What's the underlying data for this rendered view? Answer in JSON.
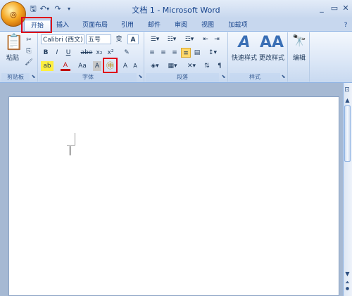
{
  "window": {
    "title": "文档 1 - Microsoft Word",
    "minimize": "_",
    "maximize": "▭",
    "close": "✕"
  },
  "qat": {
    "save": "🖫",
    "undo": "↶",
    "undo_drop": "▾",
    "redo": "↷",
    "customize": "▾"
  },
  "tabs": [
    "开始",
    "插入",
    "页面布局",
    "引用",
    "邮件",
    "审阅",
    "视图",
    "加载项"
  ],
  "help": "?",
  "clipboard": {
    "paste_label": "粘贴",
    "group_label": "剪贴板"
  },
  "font": {
    "family": "Calibri (西文)",
    "size": "五号",
    "change_case": "变",
    "char_border": "A",
    "bold": "B",
    "italic": "I",
    "underline": "U",
    "strike": "abe",
    "subscript": "x₂",
    "superscript": "x²",
    "clear_format": "✎",
    "highlight": "ab",
    "font_color": "A",
    "case": "Aa",
    "shading": "A",
    "enclosed": "㊥",
    "grow": "A",
    "shrink": "A",
    "group_label": "字体"
  },
  "paragraph": {
    "group_label": "段落"
  },
  "styles": {
    "quick_styles": "快速样式",
    "change_styles": "更改样式",
    "group_label": "样式"
  },
  "editing": {
    "label": "编辑",
    "icon": "🔭"
  },
  "scrollbar": {
    "up": "▲",
    "down": "▼",
    "ruler": "⊡"
  }
}
